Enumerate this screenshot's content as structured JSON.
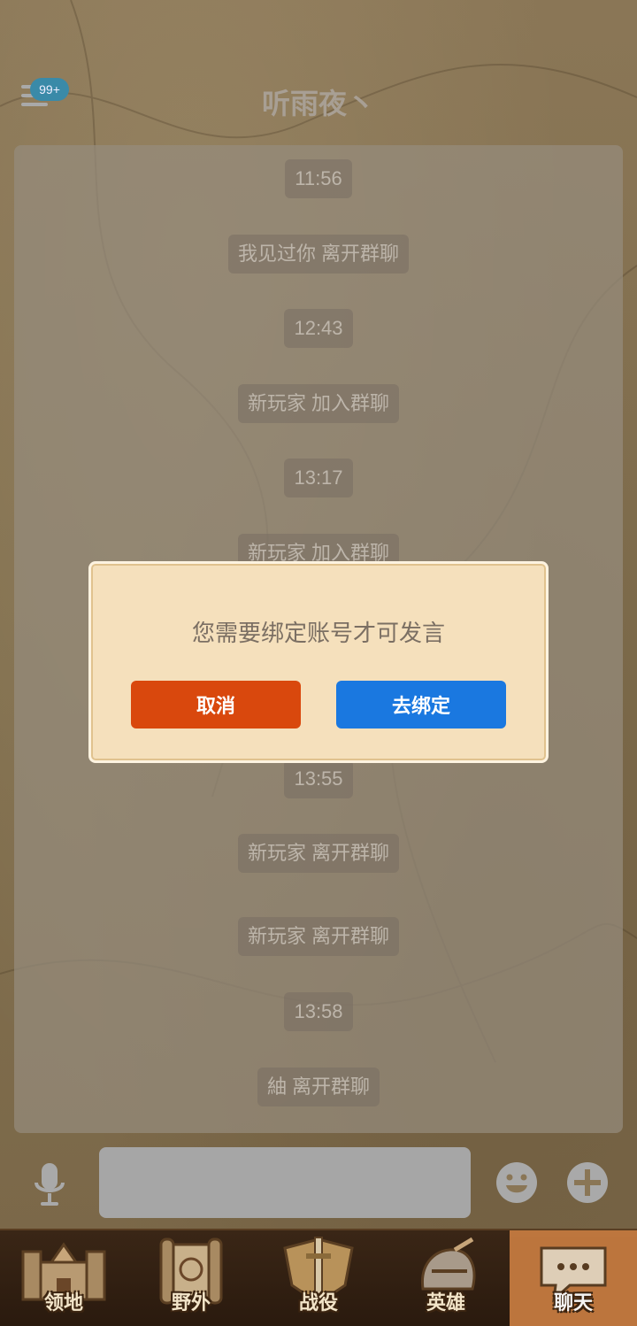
{
  "header": {
    "title": "听雨夜丶",
    "badge": "99+"
  },
  "messages": [
    {
      "type": "time",
      "text": "11:56"
    },
    {
      "type": "event",
      "text": "我见过你 离开群聊"
    },
    {
      "type": "time",
      "text": "12:43"
    },
    {
      "type": "event",
      "text": "新玩家 加入群聊"
    },
    {
      "type": "time",
      "text": "13:17"
    },
    {
      "type": "event",
      "text": "新玩家 加入群聊"
    },
    {
      "type": "time",
      "text": "13:55"
    },
    {
      "type": "event",
      "text": "新玩家 离开群聊"
    },
    {
      "type": "event",
      "text": "新玩家 离开群聊"
    },
    {
      "type": "time",
      "text": "13:58"
    },
    {
      "type": "event",
      "text": "紬 离开群聊"
    }
  ],
  "input": {
    "placeholder": ""
  },
  "dialog": {
    "message": "您需要绑定账号才可发言",
    "cancel_label": "取消",
    "confirm_label": "去绑定"
  },
  "tabs": [
    {
      "label": "领地",
      "icon": "castle-icon",
      "active": false
    },
    {
      "label": "野外",
      "icon": "scroll-map-icon",
      "active": false
    },
    {
      "label": "战役",
      "icon": "sword-shield-icon",
      "active": false
    },
    {
      "label": "英雄",
      "icon": "helmet-icon",
      "active": false
    },
    {
      "label": "聊天",
      "icon": "chat-bubble-icon",
      "active": true
    }
  ],
  "colors": {
    "cancel": "#d9480d",
    "confirm": "#1a78e0",
    "dialog_bg": "#f5e0bc",
    "badge": "#3a8aa8"
  }
}
